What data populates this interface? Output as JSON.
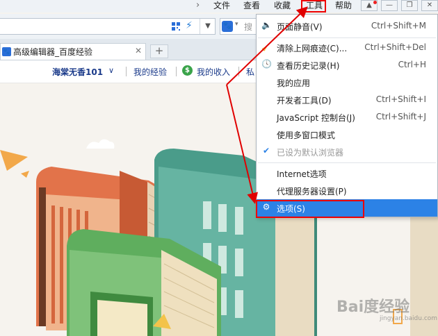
{
  "menubar": {
    "arrow": "›",
    "items": [
      "文件",
      "查看",
      "收藏",
      "工具",
      "帮助"
    ],
    "window_buttons": [
      "▲",
      "—",
      "❐",
      "✕"
    ]
  },
  "address": {
    "dropdown_glyph": "▼",
    "search_engine_caret": "▾",
    "search_placeholder": "搜"
  },
  "tabs": [
    {
      "title": "高级编辑器_百度经验",
      "close": "✕"
    }
  ],
  "new_tab": "+",
  "page_nav": {
    "user_name": "海棠无香101",
    "user_caret": "∨",
    "link_experience": "我的经验",
    "coin_glyph": "$",
    "link_income": "我的收入",
    "link_private": "私"
  },
  "tools_menu": {
    "items": [
      {
        "label": "页面静音(V)",
        "shortcut": "Ctrl+Shift+M",
        "icon": "speaker-icon"
      },
      {
        "label": "清除上网痕迹(C)...",
        "shortcut": "Ctrl+Shift+Del",
        "icon": "broom-icon"
      },
      {
        "label": "查看历史记录(H)",
        "shortcut": "Ctrl+H",
        "icon": "clock-icon"
      },
      {
        "label": "我的应用",
        "shortcut": ""
      },
      {
        "label": "开发者工具(D)",
        "shortcut": "Ctrl+Shift+I"
      },
      {
        "label": "JavaScript 控制台(J)",
        "shortcut": "Ctrl+Shift+J"
      },
      {
        "label": "使用多窗口模式",
        "shortcut": ""
      },
      {
        "label": "已设为默认浏览器",
        "shortcut": "",
        "icon": "checkmark-icon",
        "disabled": true
      },
      {
        "label": "Internet选项",
        "shortcut": ""
      },
      {
        "label": "代理服务器设置(P)",
        "shortcut": ""
      },
      {
        "label": "选项(S)",
        "shortcut": "",
        "icon": "gear-icon",
        "selected": true
      }
    ]
  },
  "watermark": {
    "text": "Bai度经验",
    "sub": "jingyan.baidu.com"
  },
  "colors": {
    "highlight": "#2c82e6",
    "annotation_red": "#e00000",
    "link_blue": "#1a3a8a"
  }
}
